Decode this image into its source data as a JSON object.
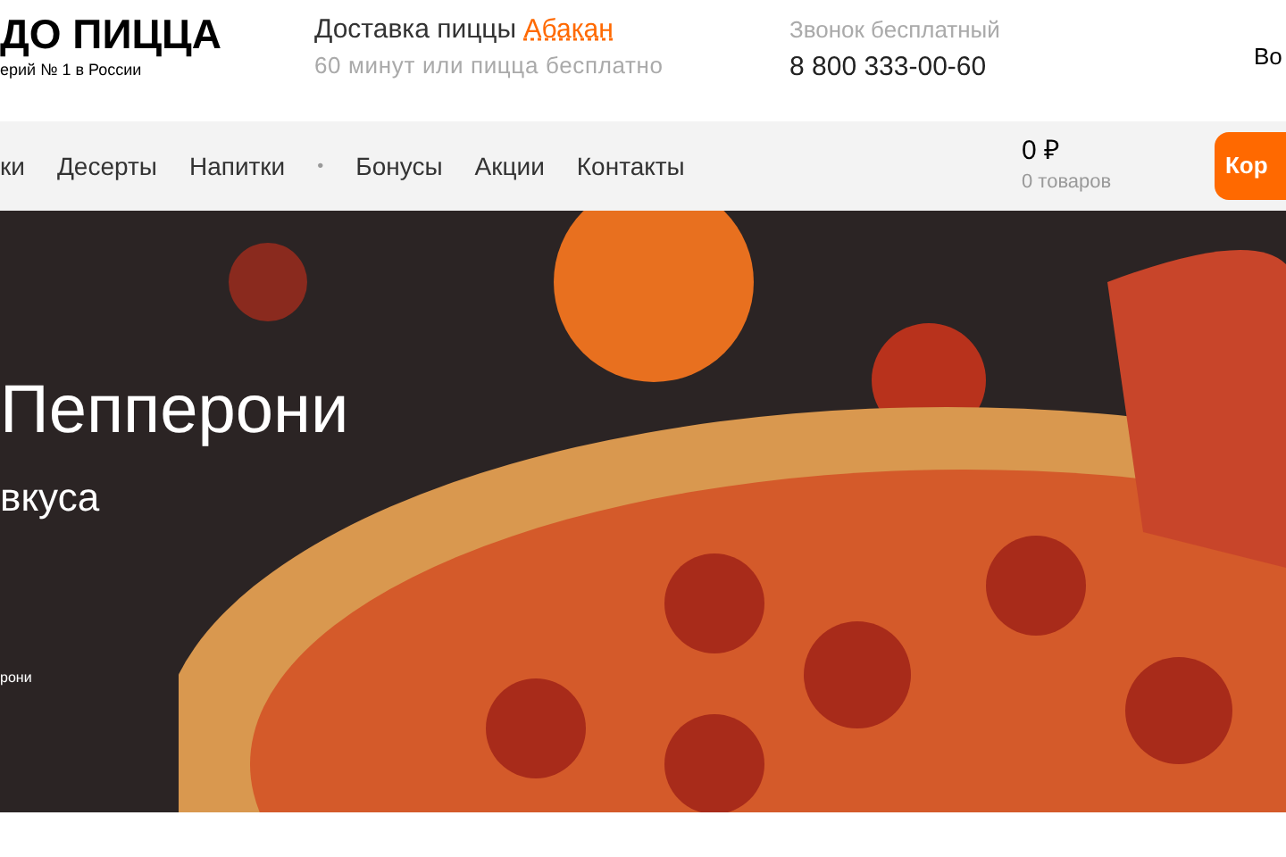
{
  "header": {
    "logo": "ДО ПИЦЦА",
    "tagline": "ерий № 1 в России",
    "delivery_label": "Доставка пиццы",
    "city": "Абакан",
    "delivery_note": "60 минут или пицца бесплатно",
    "call_label": "Звонок бесплатный",
    "phone": "8 800 333-00-60",
    "login": "Во"
  },
  "nav": {
    "items": [
      {
        "label": "ки",
        "kind": "link"
      },
      {
        "label": "Десерты",
        "kind": "link"
      },
      {
        "label": "Напитки",
        "kind": "link"
      },
      {
        "label": "•",
        "kind": "separator"
      },
      {
        "label": "Бонусы",
        "kind": "link"
      },
      {
        "label": "Акции",
        "kind": "link"
      },
      {
        "label": "Контакты",
        "kind": "link"
      }
    ],
    "cart_total": "0 ₽",
    "cart_count": "0 товаров",
    "cart_button": "Кор"
  },
  "banner": {
    "title": "Пепперони",
    "subtitle": "вкуса",
    "caption": "рони"
  }
}
